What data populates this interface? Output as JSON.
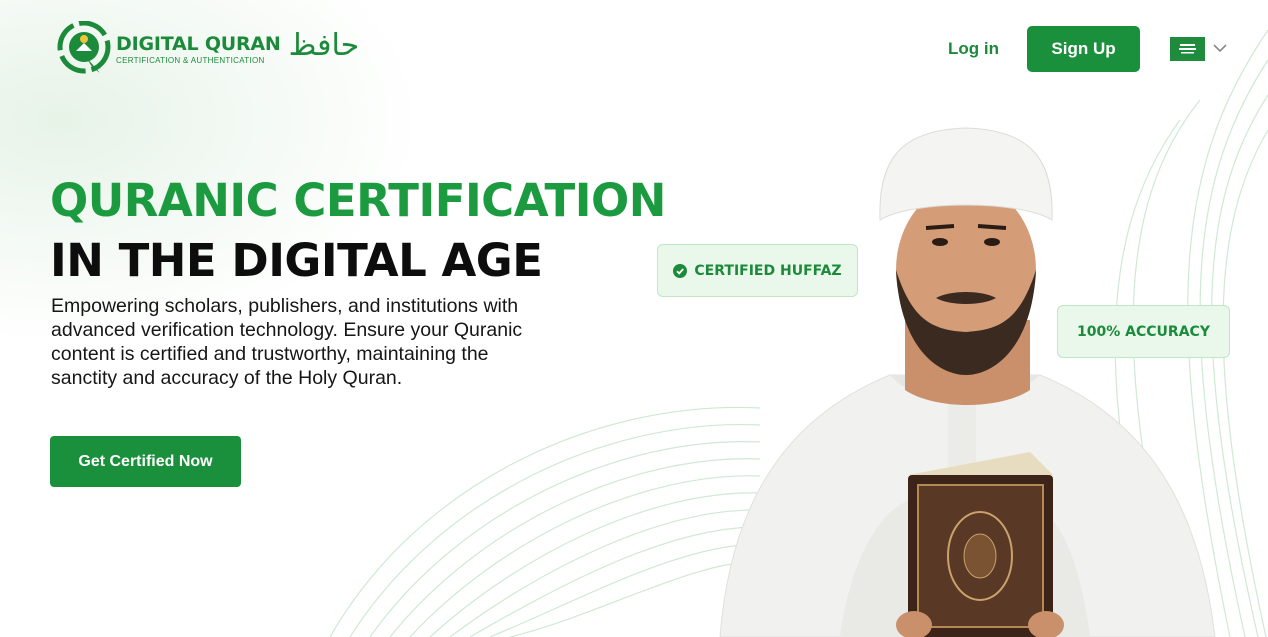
{
  "header": {
    "logo": {
      "title": "DIGITAL QURAN",
      "subtitle": "CERTIFICATION & AUTHENTICATION",
      "arabic": "حافظ"
    },
    "login_label": "Log in",
    "signup_label": "Sign Up",
    "language_icon": "saudi-flag-icon"
  },
  "hero": {
    "heading_green": "QURANIC CERTIFICATION",
    "heading_black": "IN THE DIGITAL AGE",
    "description": "Empowering scholars, publishers, and institutions with advanced verification technology. Ensure your Quranic content is certified and trustworthy, maintaining the sanctity and accuracy of the Holy Quran.",
    "cta_label": "Get Certified Now"
  },
  "badges": {
    "certified": "CERTIFIED HUFFAZ",
    "accuracy": "100% ACCURACY"
  },
  "colors": {
    "brand_green": "#1a8f3c",
    "heading_green": "#1b9a3f",
    "badge_bg": "#e8f8ea"
  }
}
